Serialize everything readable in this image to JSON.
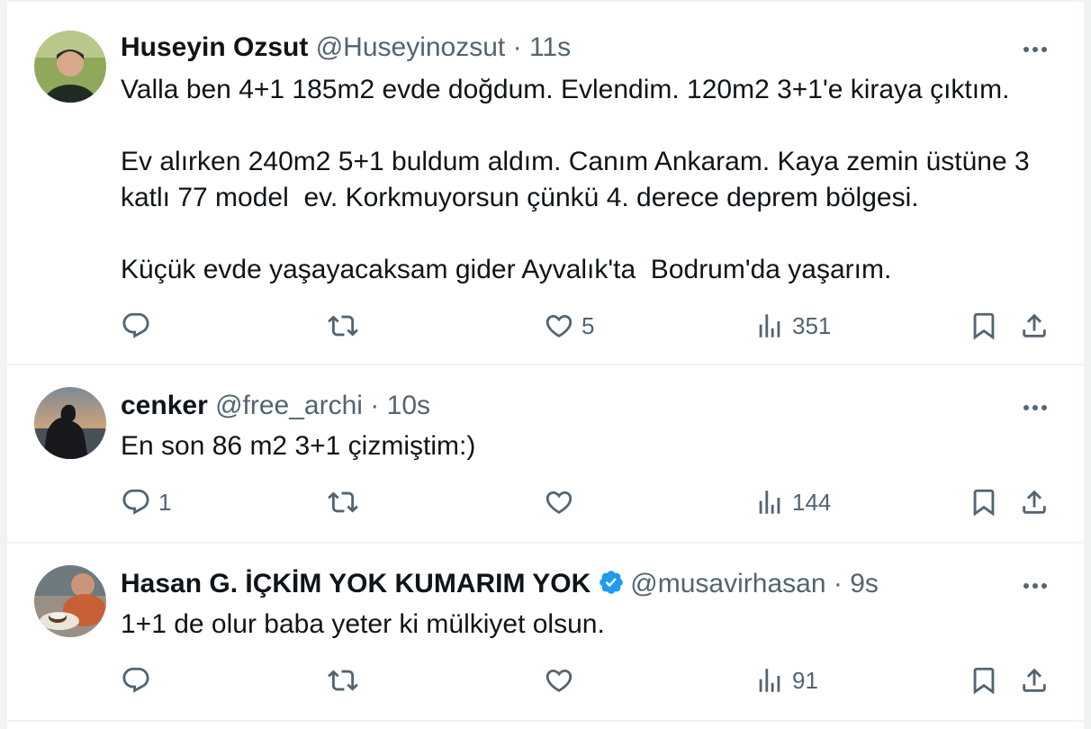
{
  "tweets": [
    {
      "name": "Huseyin Ozsut",
      "handle": "@Huseyinozsut",
      "separator": "·",
      "time": "11s",
      "verified": false,
      "paragraphs": [
        "Valla ben 4+1 185m2 evde doğdum. Evlendim. 120m2 3+1'e kiraya çıktım.",
        "Ev alırken 240m2 5+1 buldum aldım. Canım Ankaram. Kaya zemin üstüne 3\nkatlı 77 model  ev. Korkmuyorsun çünkü 4. derece deprem bölgesi.",
        "Küçük evde yaşayacaksam gider Ayvalık'ta  Bodrum'da yaşarım."
      ],
      "replies": "",
      "retweets": "",
      "likes": "5",
      "views": "351"
    },
    {
      "name": "cenker",
      "handle": "@free_archi",
      "separator": "·",
      "time": "10s",
      "verified": false,
      "paragraphs": [
        "En son 86 m2 3+1 çizmiştim:)"
      ],
      "replies": "1",
      "retweets": "",
      "likes": "",
      "views": "144"
    },
    {
      "name": "Hasan G. İÇKİM YOK KUMARIM YOK",
      "handle": "@musavirhasan",
      "separator": "·",
      "time": "9s",
      "verified": true,
      "paragraphs": [
        "1+1 de olur baba yeter ki mülkiyet olsun."
      ],
      "replies": "",
      "retweets": "",
      "likes": "",
      "views": "91"
    }
  ],
  "icons": {
    "reply": "reply-icon",
    "retweet": "retweet-icon",
    "like": "heart-icon",
    "views": "views-chart-icon",
    "bookmark": "bookmark-icon",
    "share": "share-icon",
    "more": "more-horizontal-icon",
    "verified": "verified-badge-icon"
  },
  "colors": {
    "text": "#0f1419",
    "secondary": "#536471",
    "divider": "#eff3f4",
    "verified": "#1d9bf0"
  }
}
